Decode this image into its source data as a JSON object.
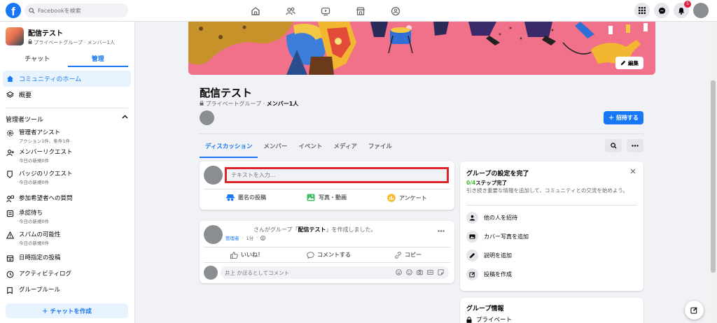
{
  "topbar": {
    "logo": "f",
    "search_placeholder": "Facebookを検索",
    "notification_count": "5",
    "nav_icons": [
      "home-icon",
      "friends-icon",
      "watch-icon",
      "marketplace-icon",
      "groups-icon"
    ]
  },
  "sidebar": {
    "group_name": "配信テスト",
    "group_meta": "プライベートグループ · メンバー1人",
    "tabs": [
      "チャット",
      "管理"
    ],
    "nav": [
      {
        "label": "コミュニティのホーム",
        "icon": "home-icon"
      },
      {
        "label": "概要",
        "icon": "layers-icon"
      }
    ],
    "admin_tools_label": "管理者ツール",
    "tools": [
      {
        "title": "管理者アシスト",
        "sub": "アクション1件、条件1件",
        "icon": "gear-icon"
      },
      {
        "title": "メンバーリクエスト",
        "sub": "今日の新規0件",
        "icon": "add-person-icon"
      },
      {
        "title": "バッジのリクエスト",
        "sub": "今日の新規0件",
        "icon": "badge-icon"
      },
      {
        "title": "参加希望者への質問",
        "sub": "",
        "icon": "question-icon"
      },
      {
        "title": "承認待ち",
        "sub": "今日の新規0件",
        "icon": "pending-icon"
      },
      {
        "title": "スパムの可能性",
        "sub": "今日の新規0件",
        "icon": "warning-icon"
      },
      {
        "title": "日時指定の投稿",
        "sub": "",
        "icon": "calendar-icon"
      },
      {
        "title": "アクティビティログ",
        "sub": "",
        "icon": "clock-icon"
      },
      {
        "title": "グループルール",
        "sub": "",
        "icon": "rules-icon"
      }
    ],
    "create_chat": "＋ チャットを作成"
  },
  "cover": {
    "edit_label": "編集"
  },
  "group": {
    "title": "配信テスト",
    "privacy": "プライベートグループ · ",
    "members": "メンバー1人",
    "invite_label": "＋ 招待する",
    "tabs": [
      "ディスカッション",
      "メンバー",
      "イベント",
      "メディア",
      "ファイル"
    ]
  },
  "composer": {
    "placeholder": "テキストを入力...",
    "actions": [
      "匿名の投稿",
      "写真・動画",
      "アンケート"
    ]
  },
  "post": {
    "text_prefix": "さんがグループ「",
    "group": "配信テスト",
    "text_suffix": "」を作成しました。",
    "role": "管理者",
    "time": "1分",
    "actions": [
      "いいね！",
      "コメントする",
      "コピー"
    ],
    "comment_placeholder": "井上 かほるとしてコメント"
  },
  "setup": {
    "title": "グループの設定を完了",
    "progress_count": "0/4",
    "progress_text": "ステップ完了",
    "desc": "引き続き重要な情報を追加して、コミュニティとの交流を始めよう。",
    "steps": [
      "他の人を招待",
      "カバー写真を追加",
      "説明を追加",
      "投稿を作成"
    ]
  },
  "info": {
    "title": "グループ情報",
    "privacy": "プライベート"
  },
  "colors": {
    "brand": "#1877f2",
    "highlight_border": "#e0242c",
    "progress_green": "#42b72a"
  }
}
